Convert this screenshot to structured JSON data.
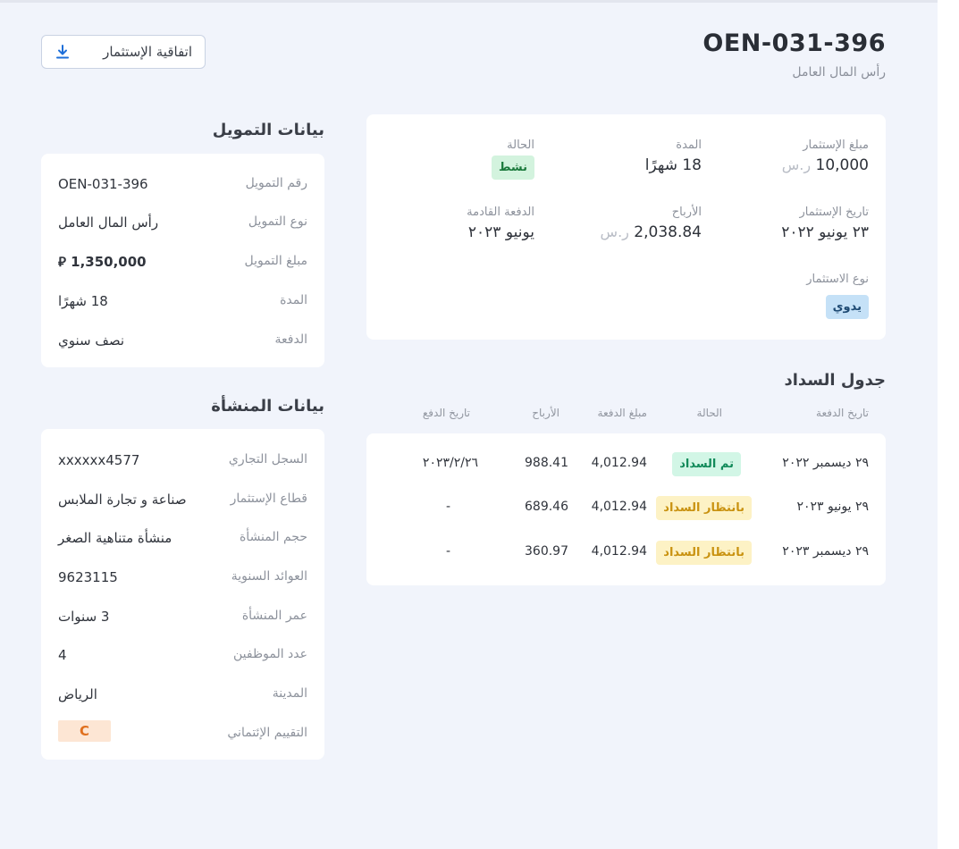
{
  "header": {
    "title": "OEN-031-396",
    "subtitle": "رأس المال العامل",
    "download_label": "اتفاقية الإستثمار"
  },
  "summary": {
    "amount_label": "مبلغ الإستثمار",
    "amount_value": "10,000",
    "amount_currency": "ر.س",
    "duration_label": "المدة",
    "duration_value": "18 شهرًا",
    "status_label": "الحالة",
    "status_value": "نشط",
    "date_label": "تاريخ الإستثمار",
    "date_value": "٢٣ يونيو ٢٠٢٢",
    "profit_label": "الأرباح",
    "profit_value": "2,038.84",
    "profit_currency": "ر.س",
    "next_payment_label": "الدفعة القادمة",
    "next_payment_value": "يونيو ٢٠٢٣",
    "type_label": "نوع الاستثمار",
    "type_value": "يدوي"
  },
  "financing": {
    "title": "بيانات التمويل",
    "rows": [
      {
        "label": "رقم التمويل",
        "value": "OEN-031-396"
      },
      {
        "label": "نوع التمويل",
        "value": "رأس المال العامل"
      },
      {
        "label": "مبلغ التمويل",
        "value": "1,350,000 ⃁"
      },
      {
        "label": "المدة",
        "value": "18 شهرًا"
      },
      {
        "label": "الدفعة",
        "value": "نصف سنوي"
      }
    ]
  },
  "establishment": {
    "title": "بيانات المنشأة",
    "rows": [
      {
        "label": "السجل التجاري",
        "value": "xxxxxx4577"
      },
      {
        "label": "قطاع الإستثمار",
        "value": "صناعة و تجارة الملابس"
      },
      {
        "label": "حجم المنشأة",
        "value": "منشأة متناهية الصغر"
      },
      {
        "label": "العوائد السنوية",
        "value": "9623115"
      },
      {
        "label": "عمر المنشأة",
        "value": "3 سنوات"
      },
      {
        "label": "عدد الموظفين",
        "value": "4"
      },
      {
        "label": "المدينة",
        "value": "الرياض"
      },
      {
        "label": "التقييم الإئتماني",
        "value": "C"
      }
    ]
  },
  "schedule": {
    "title": "جدول السداد",
    "headers": {
      "due_date": "تاريخ الدفعة",
      "status": "الحالة",
      "amount": "مبلغ الدفعة",
      "profit": "الأرباح",
      "paid_date": "تاريخ الدفع"
    },
    "rows": [
      {
        "due_date": "٢٩ ديسمبر ٢٠٢٢",
        "status": "تم السداد",
        "amount": "4,012.94",
        "profit": "988.41",
        "paid_date": "٢٠٢٣/٢/٢٦"
      },
      {
        "due_date": "٢٩ يونيو ٢٠٢٣",
        "status": "بانتظار السداد",
        "amount": "4,012.94",
        "profit": "689.46",
        "paid_date": "-"
      },
      {
        "due_date": "٢٩ ديسمبر ٢٠٢٣",
        "status": "بانتظار السداد",
        "amount": "4,012.94",
        "profit": "360.97",
        "paid_date": "-"
      }
    ]
  },
  "colors": {
    "page_bg": "#f1f4fb",
    "status_active_bg": "#d3f3de",
    "paid_bg": "#d2f6e6",
    "pending_bg": "#fdf2c5",
    "manual_bg": "#c5e1f7",
    "grade_bg": "#fde6d4",
    "download_icon": "#1e6fd9"
  },
  "icons": {
    "download": "download-icon",
    "currency": "riyal-symbol"
  }
}
